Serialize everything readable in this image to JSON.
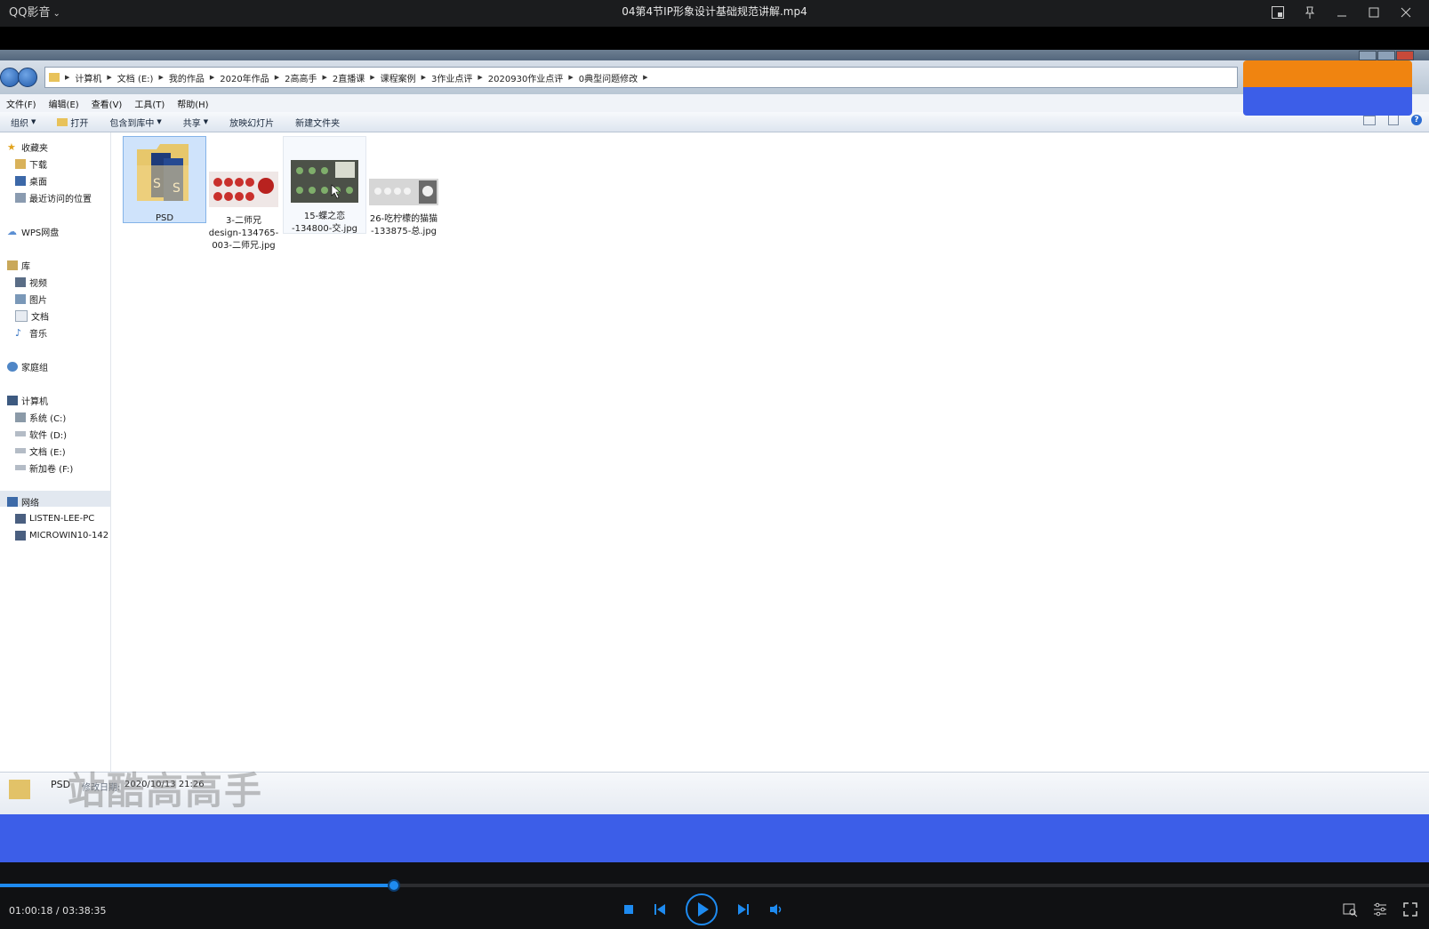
{
  "player": {
    "app_name": "QQ影音",
    "video_title": "04第4节IP形象设计基础规范讲解.mp4",
    "time_current": "01:00:18",
    "time_total": "03:38:35",
    "time_display": "01:00:18 / 03:38:35",
    "progress_fraction": 0.2754,
    "accent_color": "#1e8bf0"
  },
  "explorer": {
    "breadcrumbs": [
      "计算机",
      "文档 (E:)",
      "我的作品",
      "2020年作品",
      "2高高手",
      "2直播课",
      "课程案例",
      "3作业点评",
      "2020930作业点评",
      "0典型问题修改"
    ],
    "menu": [
      "文件(F)",
      "编辑(E)",
      "查看(V)",
      "工具(T)",
      "帮助(H)"
    ],
    "toolbar": {
      "organize": "组织",
      "open": "打开",
      "include": "包含到库中",
      "share": "共享",
      "slideshow": "放映幻灯片",
      "new_folder": "新建文件夹"
    },
    "nav": {
      "favorites": "收藏夹",
      "downloads": "下载",
      "desktop": "桌面",
      "recent": "最近访问的位置",
      "wps": "WPS网盘",
      "libraries": "库",
      "videos": "视频",
      "pictures": "图片",
      "documents": "文档",
      "music": "音乐",
      "homegroup": "家庭组",
      "computer": "计算机",
      "drive_c": "系统 (C:)",
      "drive_d": "软件 (D:)",
      "drive_e": "文档 (E:)",
      "drive_f": "新加卷 (F:)",
      "network": "网络",
      "pc1": "LISTEN-LEE-PC",
      "pc2": "MICROWIN10-142"
    },
    "files": [
      {
        "name": "PSD"
      },
      {
        "name_line1": "3-二师兄",
        "name_line2": "design-134765-",
        "name_line3": "003-二师兄.jpg"
      },
      {
        "name_line1": "15-蝶之恋",
        "name_line2": "-134800-交.jpg"
      },
      {
        "name_line1": "26-吃柠檬的猫猫",
        "name_line2": "-133875-总.jpg"
      }
    ],
    "status": {
      "name": "PSD",
      "label": "修改日期:",
      "date": "2020/10/13 21:26"
    },
    "watermark": "站酷高高手"
  },
  "colors": {
    "overlay_orange": "#f08410",
    "overlay_blue": "#3c5ee8"
  }
}
